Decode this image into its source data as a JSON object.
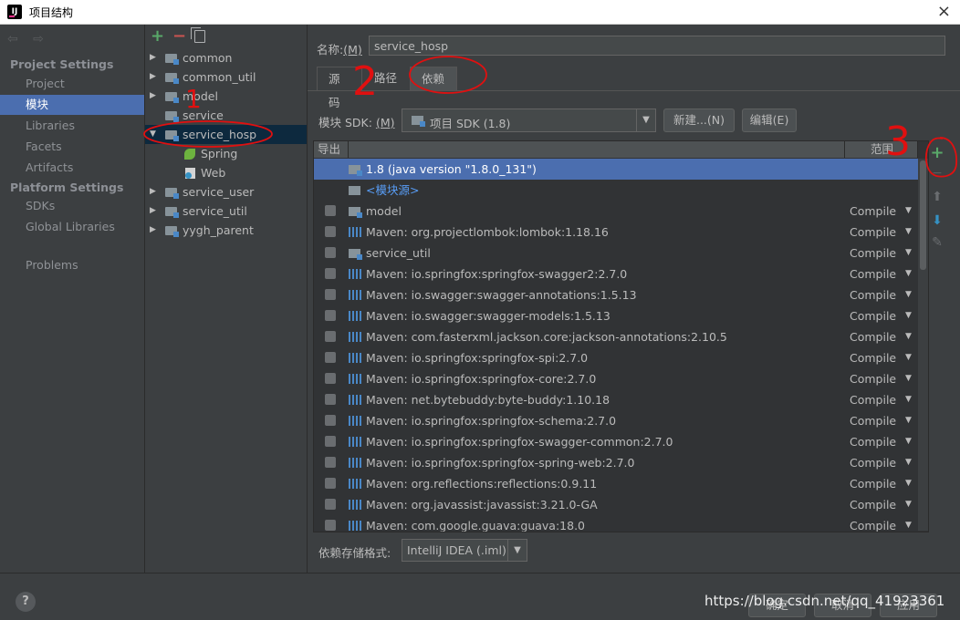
{
  "window": {
    "title": "项目结构",
    "app_icon_text": "IJ",
    "close_glyph": "×"
  },
  "left_panel": {
    "nav_arrows": "⇦ ⇨",
    "project_settings_header": "Project Settings",
    "platform_settings_header": "Platform Settings",
    "items": [
      {
        "label": "Project"
      },
      {
        "label": "模块"
      },
      {
        "label": "Libraries"
      },
      {
        "label": "Facets"
      },
      {
        "label": "Artifacts"
      }
    ],
    "platform_items": [
      {
        "label": "SDKs"
      },
      {
        "label": "Global Libraries"
      }
    ],
    "problems": "Problems"
  },
  "tree_toolbar": {
    "add": "+",
    "remove": "−"
  },
  "tree": {
    "rows": [
      {
        "label": "common"
      },
      {
        "label": "common_util"
      },
      {
        "label": "model"
      },
      {
        "label": "service"
      },
      {
        "label": "service_hosp"
      },
      {
        "label": "Spring"
      },
      {
        "label": "Web"
      },
      {
        "label": "service_user"
      },
      {
        "label": "service_util"
      },
      {
        "label": "yygh_parent"
      }
    ]
  },
  "main": {
    "name_label": "名称:",
    "name_label_key": "(M)",
    "name_value": "service_hosp",
    "tabs": [
      {
        "label": "源码"
      },
      {
        "label": "路径"
      },
      {
        "label": "依赖"
      }
    ],
    "sdk_label": "模块 SDK:",
    "sdk_label_key": "(M)",
    "sdk_value": "项目 SDK (1.8)",
    "new_button": "新建...(N)",
    "edit_button": "编辑(E)",
    "table_headers": {
      "export": "导出",
      "scope": "范围"
    },
    "dependencies": [
      {
        "name": "1.8 (java version \"1.8.0_131\")",
        "scope": ""
      },
      {
        "name": "<模块源>",
        "scope": ""
      },
      {
        "name": "model",
        "scope": "Compile"
      },
      {
        "name": "Maven: org.projectlombok:lombok:1.18.16",
        "scope": "Compile"
      },
      {
        "name": "service_util",
        "scope": "Compile"
      },
      {
        "name": "Maven: io.springfox:springfox-swagger2:2.7.0",
        "scope": "Compile"
      },
      {
        "name": "Maven: io.swagger:swagger-annotations:1.5.13",
        "scope": "Compile"
      },
      {
        "name": "Maven: io.swagger:swagger-models:1.5.13",
        "scope": "Compile"
      },
      {
        "name": "Maven: com.fasterxml.jackson.core:jackson-annotations:2.10.5",
        "scope": "Compile"
      },
      {
        "name": "Maven: io.springfox:springfox-spi:2.7.0",
        "scope": "Compile"
      },
      {
        "name": "Maven: io.springfox:springfox-core:2.7.0",
        "scope": "Compile"
      },
      {
        "name": "Maven: net.bytebuddy:byte-buddy:1.10.18",
        "scope": "Compile"
      },
      {
        "name": "Maven: io.springfox:springfox-schema:2.7.0",
        "scope": "Compile"
      },
      {
        "name": "Maven: io.springfox:springfox-swagger-common:2.7.0",
        "scope": "Compile"
      },
      {
        "name": "Maven: io.springfox:springfox-spring-web:2.7.0",
        "scope": "Compile"
      },
      {
        "name": "Maven: org.reflections:reflections:0.9.11",
        "scope": "Compile"
      },
      {
        "name": "Maven: org.javassist:javassist:3.21.0-GA",
        "scope": "Compile"
      },
      {
        "name": "Maven: com.google.guava:guava:18.0",
        "scope": "Compile"
      }
    ],
    "side_tools": {
      "add": "+",
      "remove": "−",
      "up": "⬆",
      "down": "⬇",
      "edit": "✎"
    },
    "format_label": "依赖存储格式:",
    "format_value": "IntelliJ IDEA (.iml)"
  },
  "footer": {
    "help": "?",
    "ok_button": "确定",
    "cancel_button": "取消",
    "apply_button": "应用",
    "watermark": "https://blog.csdn.net/qq_41923361"
  },
  "annotations": {
    "mark_1": "1",
    "mark_2": "2",
    "mark_3": "3"
  },
  "colors": {
    "selection": "#4b6eaf",
    "tree_selection": "#0d293e",
    "annotation": "#e01010",
    "add_green": "#59a869",
    "remove_red": "#c75450",
    "link_blue": "#589df6"
  }
}
